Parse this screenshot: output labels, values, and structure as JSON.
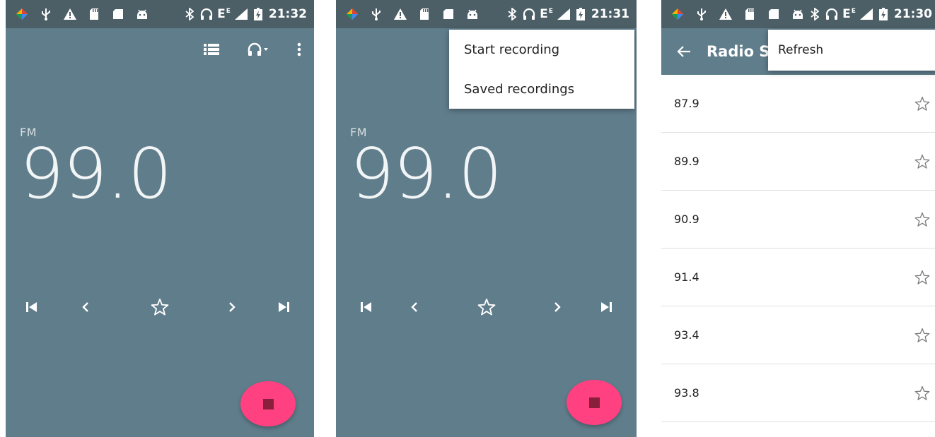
{
  "colors": {
    "background": "#607d8b",
    "status_bar": "#4c5f67",
    "fab": "#ff4081",
    "fab_stop": "#8a1f3b",
    "list_background": "#ffffff",
    "divider": "#e0e0e0"
  },
  "screens": [
    {
      "status_bar": {
        "left_icons": [
          "app-icon",
          "usb-icon",
          "warning-icon",
          "sd-card-icon",
          "sim-card-icon",
          "android-icon"
        ],
        "right_icons": [
          "bluetooth-icon",
          "headset-icon",
          "signal-icon",
          "battery-icon"
        ],
        "network": "E",
        "network_sup": "E",
        "time": "21:32"
      },
      "action_icons": [
        "list-icon",
        "headset-dropdown-icon",
        "overflow-menu-icon"
      ],
      "band": "FM",
      "frequency": "99.0",
      "controls": [
        "skip-previous-icon",
        "chevron-left-icon",
        "star-icon",
        "chevron-right-icon",
        "skip-next-icon"
      ],
      "fab_icon": "stop-icon"
    },
    {
      "status_bar": {
        "left_icons": [
          "app-icon",
          "usb-icon",
          "warning-icon",
          "sd-card-icon",
          "sim-card-icon",
          "android-icon"
        ],
        "right_icons": [
          "bluetooth-icon",
          "headset-icon",
          "signal-icon",
          "battery-icon"
        ],
        "network": "E",
        "network_sup": "E",
        "time": "21:31"
      },
      "menu": [
        "Start recording",
        "Saved recordings"
      ],
      "band": "FM",
      "frequency": "99.0",
      "controls": [
        "skip-previous-icon",
        "chevron-left-icon",
        "star-icon",
        "chevron-right-icon",
        "skip-next-icon"
      ],
      "fab_icon": "stop-icon"
    },
    {
      "status_bar": {
        "left_icons": [
          "app-icon",
          "usb-icon",
          "warning-icon",
          "sd-card-icon",
          "sim-card-icon",
          "android-icon"
        ],
        "right_icons": [
          "bluetooth-icon",
          "headset-icon",
          "signal-icon",
          "battery-icon"
        ],
        "network": "E",
        "network_sup": "E",
        "time": "21:30"
      },
      "toolbar_title": "Radio S",
      "menu": [
        "Refresh"
      ],
      "stations": [
        "87.9",
        "89.9",
        "90.9",
        "91.4",
        "93.4",
        "93.8"
      ]
    }
  ]
}
